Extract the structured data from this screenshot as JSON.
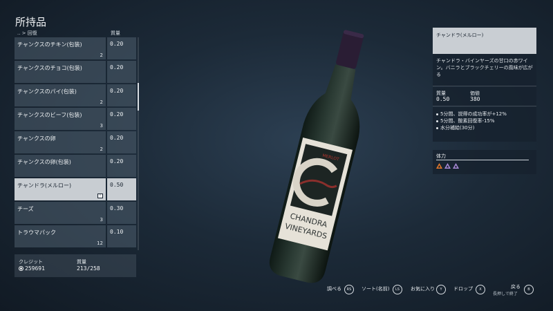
{
  "title": "所持品",
  "list_header": {
    "path": ".. > 回復",
    "mass": "質量"
  },
  "items": [
    {
      "name": "チャンクスのチキン(包装)",
      "count": "2",
      "mass": "0.20"
    },
    {
      "name": "チャンクスのチョコ(包装)",
      "count": "",
      "mass": "0.20"
    },
    {
      "name": "チャンクスのパイ(包装)",
      "count": "2",
      "mass": "0.20"
    },
    {
      "name": "チャンクスのビーフ(包装)",
      "count": "3",
      "mass": "0.20"
    },
    {
      "name": "チャンクスの卵",
      "count": "2",
      "mass": "0.20"
    },
    {
      "name": "チャンクスの卵(包装)",
      "count": "",
      "mass": "0.20"
    },
    {
      "name": "チャンドラ(メルロー)",
      "count": "",
      "mass": "0.50",
      "selected": true,
      "badge": "!"
    },
    {
      "name": "チーズ",
      "count": "3",
      "mass": "0.30"
    },
    {
      "name": "トラウマパック",
      "count": "12",
      "mass": "0.10"
    }
  ],
  "footer": {
    "credits_label": "クレジット",
    "credits_value": "259691",
    "mass_label": "質量",
    "mass_value": "213/258"
  },
  "bottle": {
    "label_top": "MERLOT",
    "label_line1": "CHANDRA",
    "label_line2": "VINEYARDS"
  },
  "detail": {
    "name": "チャンドラ(メルロー)",
    "description": "チャンドラ・バインヤーズの甘口の赤ワイン。バニラとブラックチェリーの風味が広がる",
    "mass_label": "質量",
    "mass_value": "0.50",
    "value_label": "価値",
    "value_value": "380",
    "effects": [
      "5分間、説得の成功率が+12%",
      "5分間、酸素回復率-15%",
      "水分補給(30分)"
    ],
    "health_label": "体力"
  },
  "buttons": [
    {
      "label": "調べる",
      "key": "RS"
    },
    {
      "label": "ソート(名前)",
      "key": "LS"
    },
    {
      "label": "お気に入り",
      "key": "Y"
    },
    {
      "label": "ドロップ",
      "key": "X"
    },
    {
      "label": "戻る",
      "sublabel": "長押しで終了",
      "key": "B"
    }
  ],
  "colors": {
    "selected_row": "#c9ced3",
    "panel_bg": "#16222e",
    "health_orange": "#e6782a",
    "health_purple": "#a98ad8"
  }
}
